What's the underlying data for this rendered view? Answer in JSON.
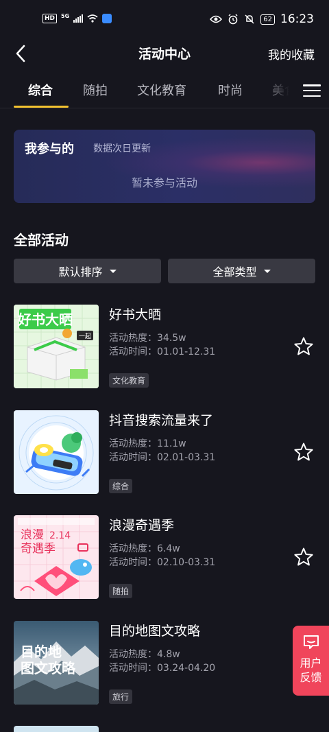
{
  "status_bar": {
    "hd": "HD",
    "net": "5G",
    "battery": "62",
    "time": "16:23"
  },
  "header": {
    "title": "活动中心",
    "favorites": "我的收藏",
    "back_icon": "chevron-left-icon"
  },
  "tabs": [
    "综合",
    "随拍",
    "文化教育",
    "时尚",
    "美食"
  ],
  "active_tab": 0,
  "my_card": {
    "title": "我参与的",
    "subtitle": "数据次日更新",
    "empty_text": "暂未参与活动"
  },
  "section": {
    "title": "全部活动",
    "sort_label": "默认排序",
    "type_label": "全部类型"
  },
  "activities": [
    {
      "title": "好书大晒",
      "hot": "活动热度：34.5w",
      "time": "活动时间：01.01-12.31",
      "tag": "文化教育",
      "thumb_text": "好书大晒",
      "thumb_badge": "一起"
    },
    {
      "title": "抖音搜索流量来了",
      "hot": "活动热度：11.1w",
      "time": "活动时间：02.01-03.31",
      "tag": "综合"
    },
    {
      "title": "浪漫奇遇季",
      "hot": "活动热度：6.4w",
      "time": "活动时间：02.10-03.31",
      "tag": "随拍",
      "thumb_text_1": "浪漫",
      "thumb_text_2": "奇遇季",
      "thumb_date": "2.14"
    },
    {
      "title": "目的地图文攻略",
      "hot": "活动热度：4.8w",
      "time": "活动时间：03.24-04.20",
      "tag": "旅行",
      "thumb_text_1": "目的地",
      "thumb_text_2": "图文攻略"
    }
  ],
  "feedback": {
    "label": "用户反馈"
  }
}
